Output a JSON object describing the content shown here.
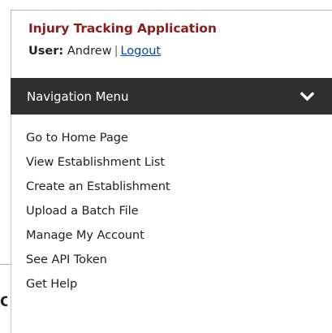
{
  "app": {
    "title": "Injury Tracking Application",
    "user_label": "User:",
    "user_name": "Andrew",
    "separator": "|",
    "logout_label": "Logout"
  },
  "nav": {
    "title": "Navigation Menu",
    "toggle_icon": "chevron-down-icon",
    "items": [
      {
        "label": "Go to Home Page"
      },
      {
        "label": "View Establishment List"
      },
      {
        "label": "Create an Establishment"
      },
      {
        "label": "Upload a Batch File"
      },
      {
        "label": "Manage My Account"
      },
      {
        "label": "See API Token"
      },
      {
        "label": "Get Help"
      }
    ]
  },
  "background": {
    "clipped_text": "C"
  },
  "colors": {
    "title": "#8a1c1c",
    "nav_bar": "#2f2f2f",
    "link": "#0645ad"
  }
}
